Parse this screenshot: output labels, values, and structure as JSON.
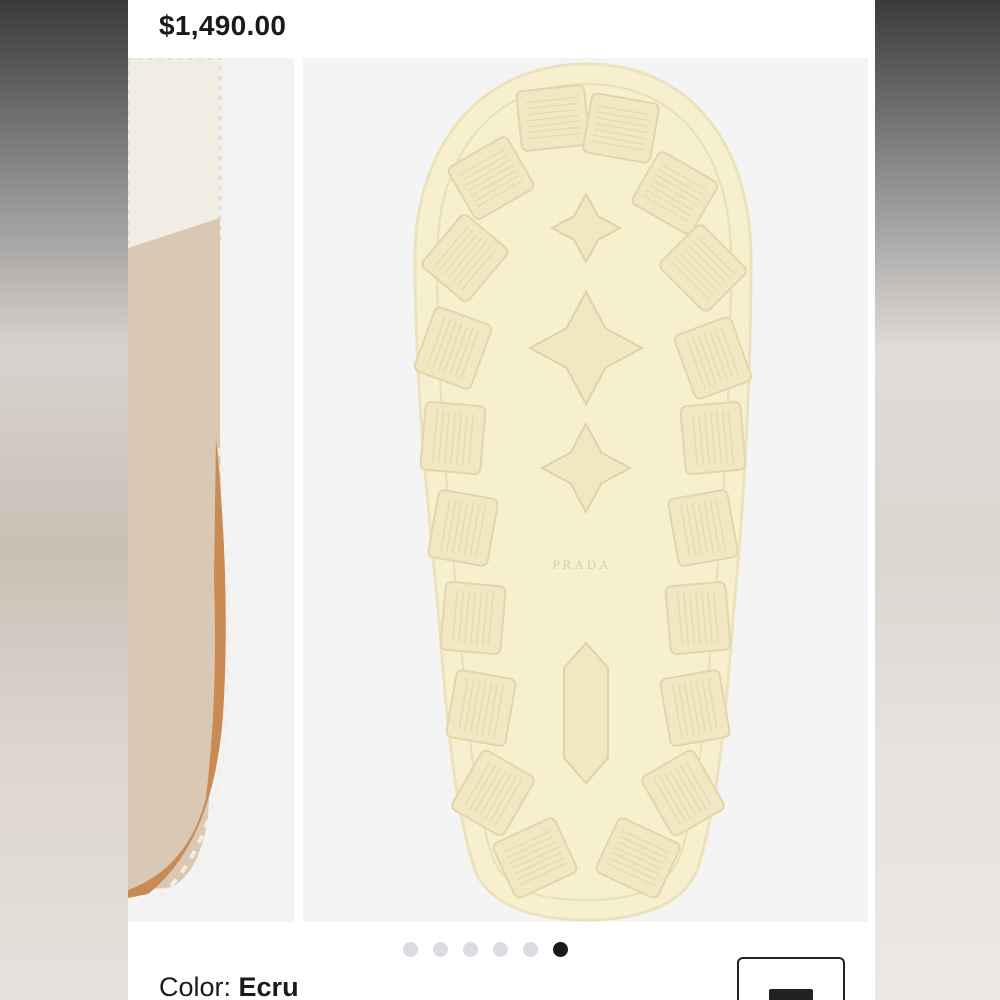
{
  "product": {
    "price": "$1,490.00",
    "color_label": "Color: ",
    "color_value": "Ecru"
  },
  "gallery": {
    "slide_count": 6,
    "active_index": 5,
    "sole_brand_text": "PRADA"
  },
  "colors": {
    "sole": "#f6f0cf",
    "lug": "#f1e8c3",
    "suede": "#d8c8b4",
    "welt": "#c98a54"
  },
  "icons": {
    "save": "save-icon"
  }
}
